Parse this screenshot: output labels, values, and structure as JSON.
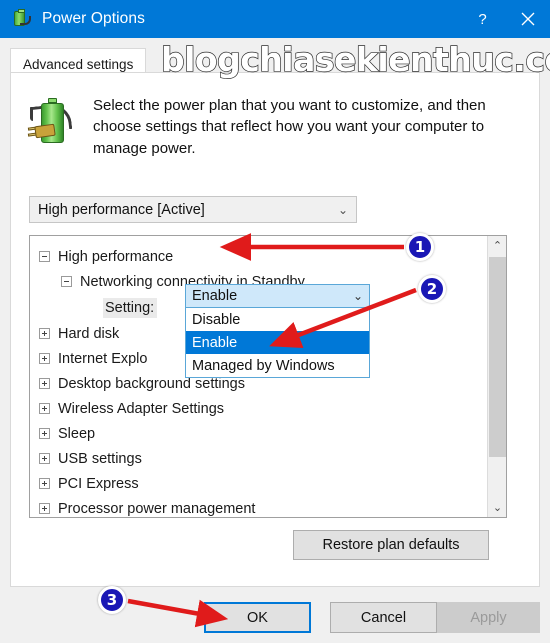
{
  "window": {
    "title": "Power Options",
    "icon": "power-plug-battery-icon",
    "help_label": "?",
    "close_label": "✕",
    "accent_color": "#0078d7"
  },
  "watermark": {
    "text": "blogchiasekienthuc.com"
  },
  "tabs": [
    {
      "label": "Advanced settings",
      "active": true
    }
  ],
  "intro": {
    "icon": "battery-power-cord-icon",
    "text": "Select the power plan that you want to customize, and then choose settings that reflect how you want your computer to manage power."
  },
  "plan_selector": {
    "name": "power-plan-combobox",
    "value": "High performance [Active]",
    "chevron": "⌄"
  },
  "tree": {
    "nodes": [
      {
        "label": "High performance",
        "level": 0,
        "state": "expanded"
      },
      {
        "label": "Networking connectivity in Standby",
        "level": 1,
        "state": "expanded"
      },
      {
        "label": "Hard disk",
        "level": 0,
        "state": "collapsed"
      },
      {
        "label": "Internet Explo",
        "level": 0,
        "state": "collapsed"
      },
      {
        "label": "Desktop background settings",
        "level": 0,
        "state": "collapsed"
      },
      {
        "label": "Wireless Adapter Settings",
        "level": 0,
        "state": "collapsed"
      },
      {
        "label": "Sleep",
        "level": 0,
        "state": "collapsed"
      },
      {
        "label": "USB settings",
        "level": 0,
        "state": "collapsed"
      },
      {
        "label": "PCI Express",
        "level": 0,
        "state": "collapsed"
      },
      {
        "label": "Processor power management",
        "level": 0,
        "state": "collapsed"
      }
    ],
    "setting": {
      "label": "Setting:",
      "value": "Enable",
      "chevron": "⌄",
      "options": [
        {
          "label": "Disable",
          "selected": false
        },
        {
          "label": "Enable",
          "selected": true
        },
        {
          "label": "Managed by Windows",
          "selected": false
        }
      ]
    },
    "scrollbar": {
      "up_arrow": "⌃",
      "down_arrow": "⌄"
    }
  },
  "buttons": {
    "restore": "Restore plan defaults",
    "ok": "OK",
    "cancel": "Cancel",
    "apply": "Apply",
    "apply_enabled": false
  },
  "annotations": {
    "badge_color": "#1a17b5",
    "arrow_color": "#e01b1b",
    "items": [
      {
        "number": "1",
        "points_to": "High performance tree node"
      },
      {
        "number": "2",
        "points_to": "Enable option in dropdown"
      },
      {
        "number": "3",
        "points_to": "OK button"
      }
    ]
  }
}
